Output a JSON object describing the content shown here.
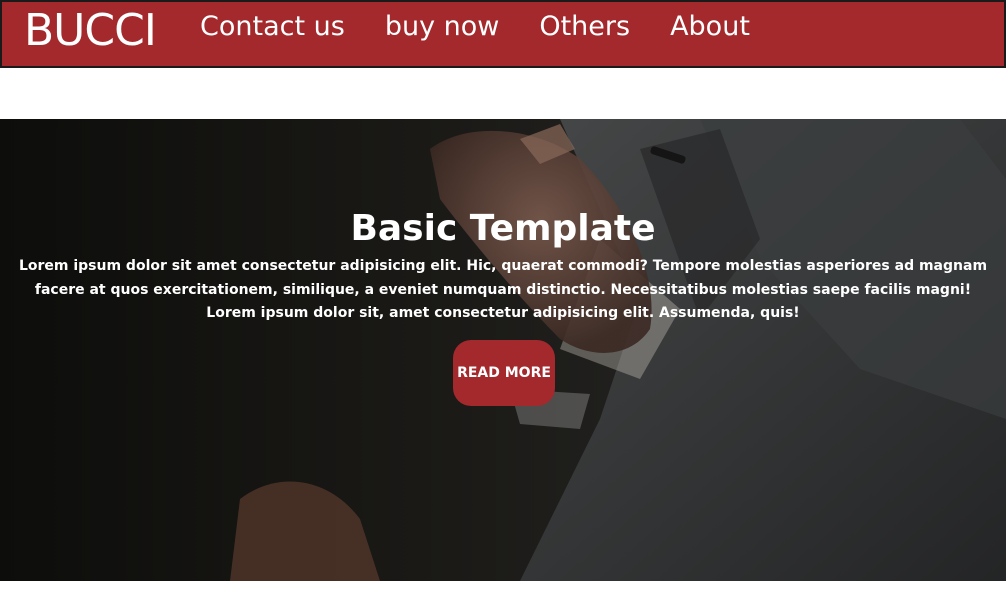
{
  "navbar": {
    "brand": "BUCCI",
    "links": [
      "Contact us",
      "buy now",
      "Others",
      "About"
    ]
  },
  "hero": {
    "title": "Basic Template",
    "text": "Lorem ipsum dolor sit amet consectetur adipisicing elit. Hic, quaerat commodi? Tempore molestias asperiores ad magnam facere at quos exercitationem, similique, a eveniet numquam distinctio. Necessitatibus molestias saepe facilis magni! Lorem ipsum dolor sit, amet consectetur adipisicing elit. Assumenda, quis!",
    "button_label": "READ MORE"
  },
  "colors": {
    "brand_red": "#a3292c",
    "hero_dark": "#1f1f1f"
  }
}
